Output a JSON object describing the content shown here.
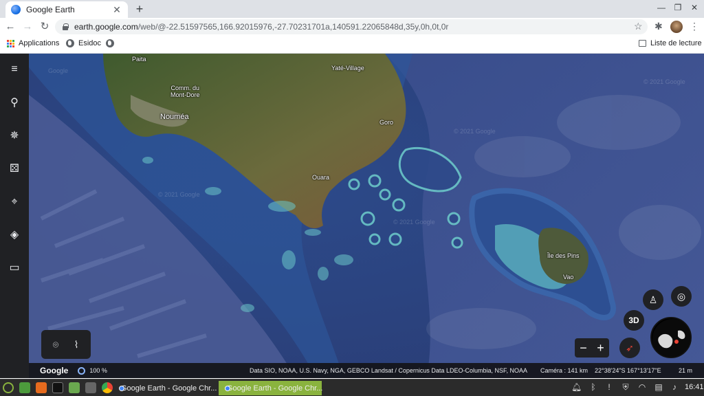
{
  "browser": {
    "tab_title": "Google Earth",
    "url_host": "earth.google.com",
    "url_path": "/web/@-22.51597565,166.92015976,-27.70231701a,140591.22065848d,35y,0h,0t,0r",
    "bookmarks": [
      "Applications",
      "Esidoc"
    ],
    "reading_list": "Liste de lecture"
  },
  "map_labels": {
    "paita": "Paita",
    "yate": "Yaté-Village",
    "mont_dore": "Comm. du\nMont-Dore",
    "noumea": "Nouméa",
    "goro": "Goro",
    "ouara": "Ouara",
    "ile_des_pins": "Île des Pins",
    "vao": "Vao"
  },
  "watermarks": {
    "google": "Google",
    "copyright": "© 2021 Google"
  },
  "controls": {
    "three_d": "3D"
  },
  "status": {
    "brand": "Google",
    "zoom": "100 %",
    "credits": "Data SIO, NOAA, U.S. Navy, NGA, GEBCO   Landsat / Copernicus   Data LDEO-Columbia, NSF, NOAA",
    "camera": "Caméra : 141 km",
    "coords": "22°38'24\"S 167°13'17\"E",
    "scale": "21 m"
  },
  "taskbar": {
    "task1": "Google Earth - Google Chr...",
    "task2": "Google Earth - Google Chr...",
    "clock": "16:41"
  },
  "colors": {
    "ocean": "#273a73",
    "reef": "#6bc6c8",
    "land": "#5a6b3a",
    "active_task": "#8ab33e"
  }
}
